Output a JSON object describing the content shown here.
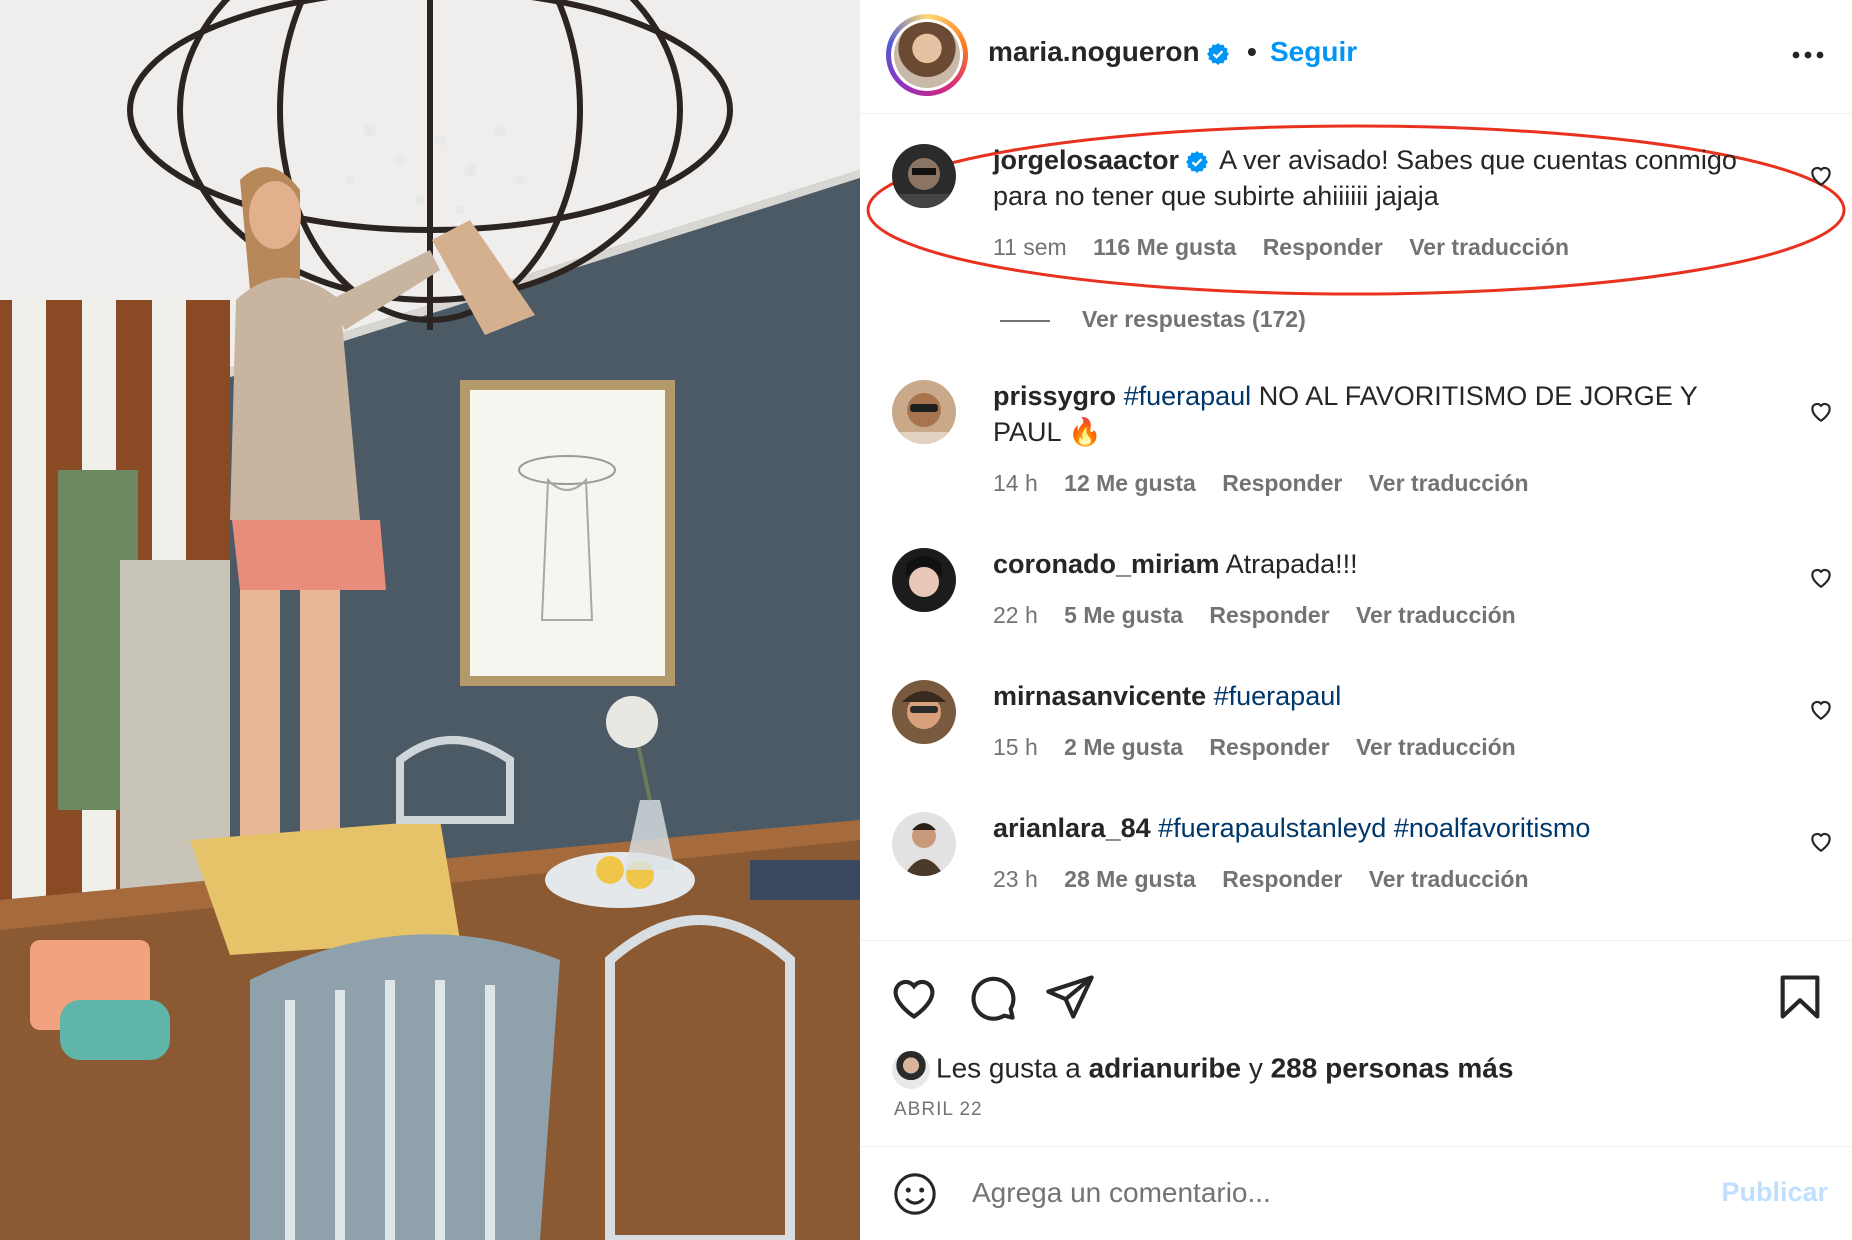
{
  "header": {
    "username": "maria.nogueron",
    "separator": "•",
    "follow_label": "Seguir"
  },
  "comments": [
    {
      "username": "jorgelosaactor",
      "verified": true,
      "text": "A ver avisado! Sabes que cuentas conmigo para no tener que subirte ahiiiiii jajaja",
      "time": "11 sem",
      "likes": "116 Me gusta",
      "reply": "Responder",
      "translate": "Ver traducción",
      "highlighted": true
    },
    {
      "username": "prissygro",
      "hashtags": [
        "#fuerapaul"
      ],
      "text": "NO AL FAVORITISMO DE JORGE Y PAUL 🔥",
      "time": "14 h",
      "likes": "12 Me gusta",
      "reply": "Responder",
      "translate": "Ver traducción"
    },
    {
      "username": "coronado_miriam",
      "text": "Atrapada!!!",
      "time": "22 h",
      "likes": "5 Me gusta",
      "reply": "Responder",
      "translate": "Ver traducción"
    },
    {
      "username": "mirnasanvicente",
      "hashtags": [
        "#fuerapaul"
      ],
      "text": "",
      "time": "15 h",
      "likes": "2 Me gusta",
      "reply": "Responder",
      "translate": "Ver traducción"
    },
    {
      "username": "arianlara_84",
      "hashtags": [
        "#fuerapaulstanleyd",
        "#noalfavoritismo"
      ],
      "text": "",
      "time": "23 h",
      "likes": "28 Me gusta",
      "reply": "Responder",
      "translate": "Ver traducción"
    }
  ],
  "view_replies": "Ver respuestas (172)",
  "likes_summary": {
    "prefix": "Les gusta a",
    "user": "adrianuribe",
    "connector": "y",
    "others": "288 personas más"
  },
  "post_date": "ABRIL 22",
  "composer": {
    "placeholder": "Agrega un comentario...",
    "publish_label": "Publicar"
  },
  "icons": [
    "more-options-icon",
    "verified-badge-icon",
    "heart-icon",
    "comment-icon",
    "share-icon",
    "save-icon",
    "emoji-icon"
  ],
  "colors": {
    "link_blue": "#0095f6",
    "hashtag": "#00376b",
    "verified": "#0095f6",
    "highlight_ellipse": "#e8321f",
    "secondary_text": "#737373",
    "publish_disabled": "#c0dffd"
  }
}
